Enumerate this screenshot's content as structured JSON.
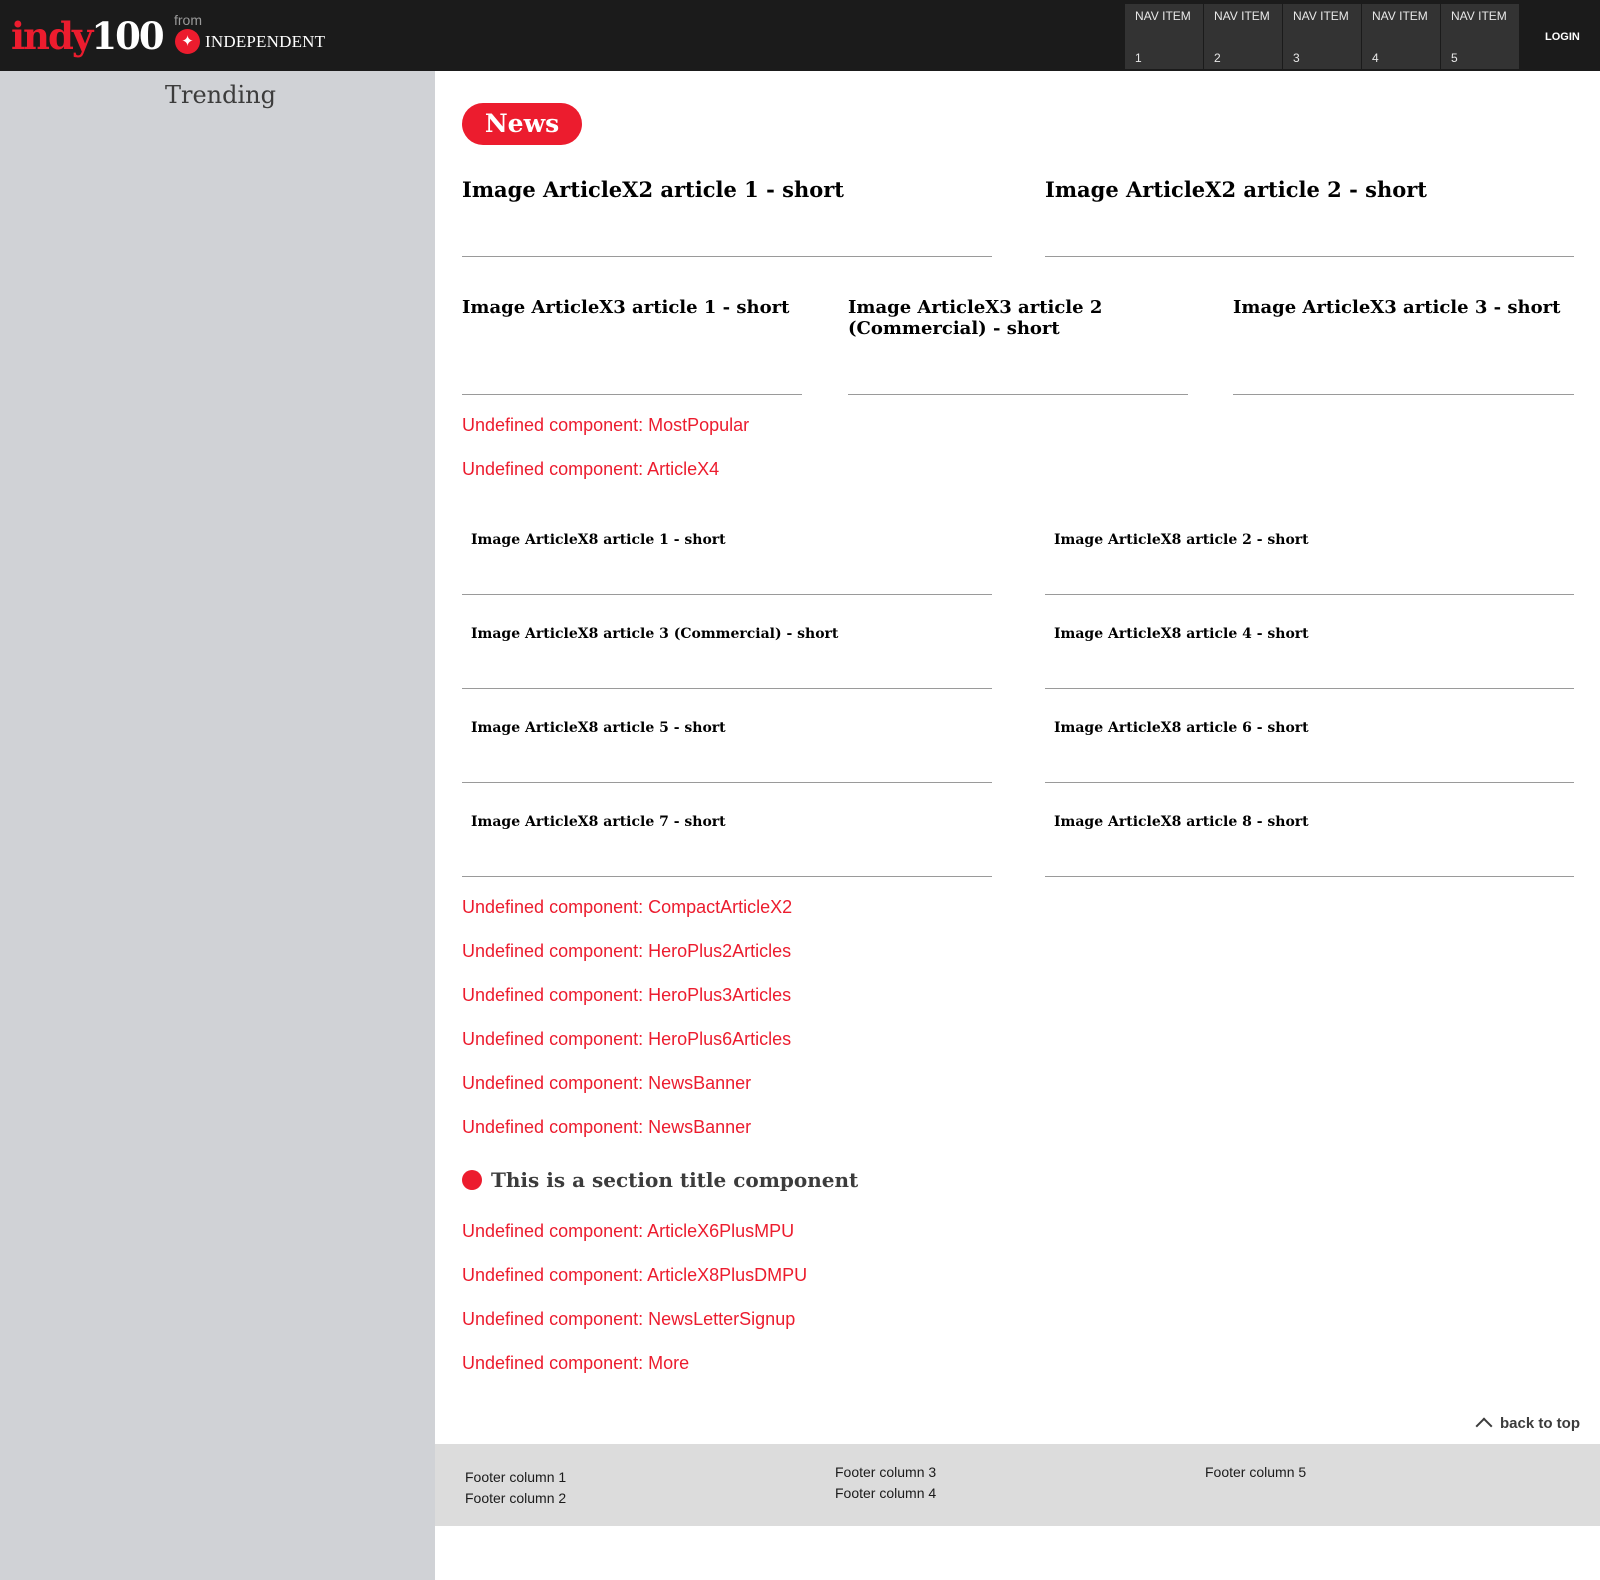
{
  "header": {
    "logo_part1": "indy",
    "logo_part2": "100",
    "from_label": "from",
    "partner_name": "INDEPENDENT",
    "partner_icon": "eagle-icon",
    "nav_items": [
      {
        "line1": "NAV ITEM",
        "line2": "1"
      },
      {
        "line1": "NAV ITEM",
        "line2": "2"
      },
      {
        "line1": "NAV ITEM",
        "line2": "3"
      },
      {
        "line1": "NAV ITEM",
        "line2": "4"
      },
      {
        "line1": "NAV ITEM",
        "line2": "5"
      }
    ],
    "login_label": "LOGIN"
  },
  "sidebar": {
    "title": "Trending"
  },
  "main": {
    "section_pill": "News",
    "articles_x2": [
      "Image ArticleX2 article 1 - short",
      "Image ArticleX2 article 2 - short"
    ],
    "articles_x3": [
      "Image ArticleX3 article 1 - short",
      "Image ArticleX3 article 2 (Commercial) - short",
      "Image ArticleX3 article 3 - short"
    ],
    "undefined_block_1": [
      "Undefined component: MostPopular",
      "Undefined component: ArticleX4"
    ],
    "articles_x8": [
      "Image ArticleX8 article 1 - short",
      "Image ArticleX8 article 2 - short",
      "Image ArticleX8 article 3 (Commercial) - short",
      "Image ArticleX8 article 4 - short",
      "Image ArticleX8 article 5 - short",
      "Image ArticleX8 article 6 - short",
      "Image ArticleX8 article 7 - short",
      "Image ArticleX8 article 8 - short"
    ],
    "undefined_block_2": [
      "Undefined component: CompactArticleX2",
      "Undefined component: HeroPlus2Articles",
      "Undefined component: HeroPlus3Articles",
      "Undefined component: HeroPlus6Articles",
      "Undefined component: NewsBanner",
      "Undefined component: NewsBanner"
    ],
    "section_title": "This is a section title component",
    "undefined_block_3": [
      "Undefined component: ArticleX6PlusMPU",
      "Undefined component: ArticleX8PlusDMPU",
      "Undefined component: NewsLetterSignup",
      "Undefined component: More"
    ],
    "back_to_top": "back to top"
  },
  "footer": {
    "columns": [
      "Footer column 1",
      "Footer column 2",
      "Footer column 3",
      "Footer column 4",
      "Footer column 5"
    ]
  },
  "colors": {
    "brand_red": "#ec1c2e",
    "header_bg": "#1b1b1b",
    "sidebar_bg": "#d0d2d6",
    "footer_bg": "#dcdcdc"
  }
}
